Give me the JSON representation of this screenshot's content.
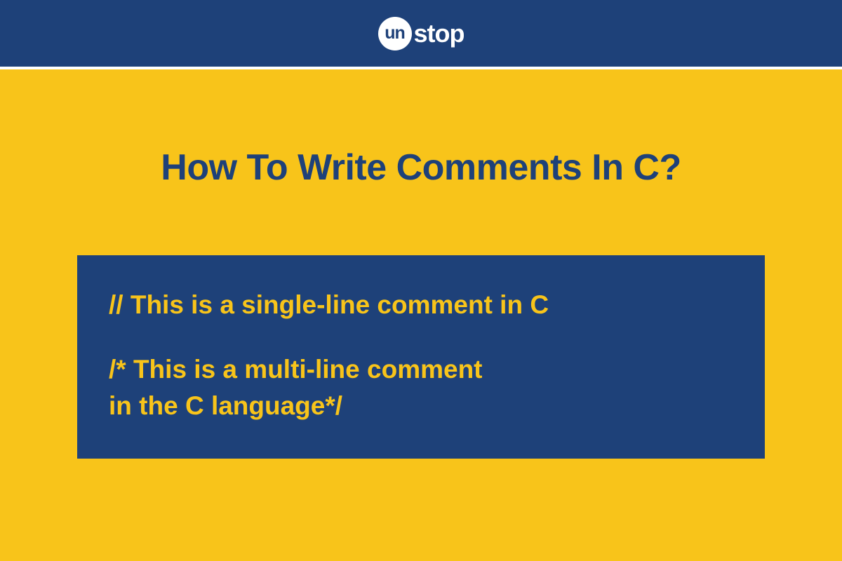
{
  "header": {
    "logo_prefix": "un",
    "logo_suffix": "stop"
  },
  "content": {
    "title": "How To Write Comments In C?",
    "single_line_comment": "// This is a single-line comment in C",
    "multi_line_comment_1": "/* This is a multi-line comment",
    "multi_line_comment_2": "in the C language*/"
  }
}
